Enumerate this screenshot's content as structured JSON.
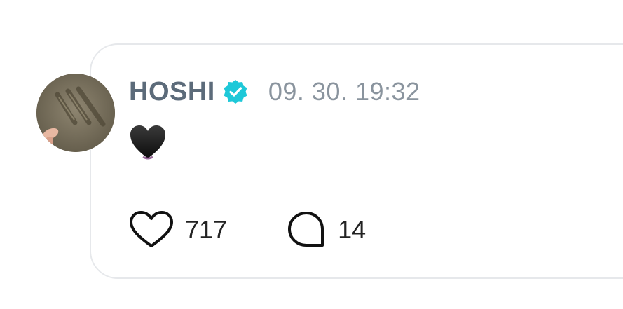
{
  "post": {
    "author": "HOSHI",
    "verified_icon": "verified-badge-icon",
    "timestamp": "09. 30. 19:32",
    "body_emoji": "black-heart-emoji",
    "avatar_icon": "avatar-photo"
  },
  "actions": {
    "like_icon": "heart-outline-icon",
    "like_count": "717",
    "comment_icon": "comment-bubble-icon",
    "comment_count": "14"
  },
  "colors": {
    "author": "#5c6b7a",
    "verified": "#1ec8d8",
    "timestamp": "#8a949e",
    "card_border": "#e6e8eb"
  }
}
